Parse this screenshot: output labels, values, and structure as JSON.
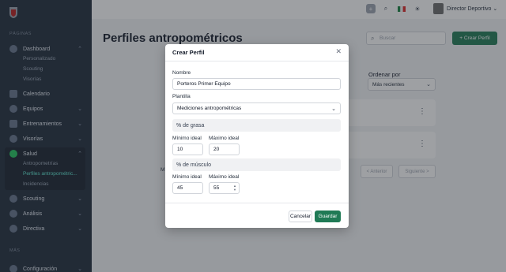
{
  "sidebar": {
    "section_pages": "PÁGINAS",
    "section_more": "MÁS",
    "dashboard": {
      "label": "Dashboard",
      "children": [
        "Personalizado",
        "Scouting",
        "Visorías"
      ]
    },
    "calendario": "Calendario",
    "equipos": "Equipos",
    "entrenamientos": "Entrenamientos",
    "visorias": "Visorías",
    "salud": {
      "label": "Salud",
      "children": [
        "Antropometrías",
        "Perfiles antropométric...",
        "Incidencias"
      ]
    },
    "scouting": "Scouting",
    "analisis": "Análisis",
    "directiva": "Directiva",
    "configuracion": "Configuración"
  },
  "topbar": {
    "user_name": "Director Deportivo",
    "icons": [
      "plus-icon",
      "search-icon",
      "mexico-flag-icon",
      "sun-icon"
    ]
  },
  "main": {
    "title": "Perfiles antropométricos",
    "search_placeholder": "Buscar",
    "create_button": "Crear Perfil",
    "order_label": "Ordenar por",
    "order_value": "Más recientes",
    "pager_prev": "< Anterior",
    "pager_next": "Siguiente >",
    "partial_text": "M"
  },
  "modal": {
    "title": "Crear Perfil",
    "name_label": "Nombre",
    "name_value": "Porteros Primer Equipo",
    "template_label": "Plantilla",
    "template_value": "Mediciones antropométricas",
    "sections": [
      {
        "title": "% de grasa",
        "min_label": "Mínimo ideal",
        "max_label": "Máximo ideal",
        "min_value": "10",
        "max_value": "20"
      },
      {
        "title": "% de músculo",
        "min_label": "Mínimo ideal",
        "max_label": "Máximo ideal",
        "min_value": "45",
        "max_value": "55"
      }
    ],
    "cancel": "Cancelar",
    "save": "Guardar"
  },
  "colors": {
    "primary": "#1f7a55",
    "sidebar": "#1e2a3a",
    "active_sub": "#5eead4"
  }
}
